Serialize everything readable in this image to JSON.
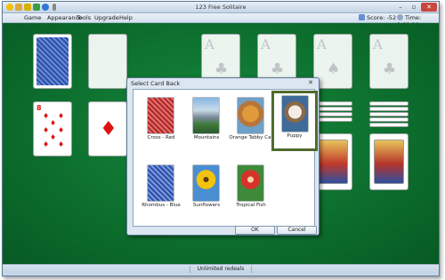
{
  "window": {
    "title": "123 Free Solitaire"
  },
  "menu": {
    "items": [
      "Game",
      "Appearance",
      "Tools",
      "Upgrade",
      "Help"
    ],
    "score_label": "Score: -52",
    "time_label": "Time: 0:01:19"
  },
  "dialog": {
    "title": "Select Card Back",
    "close_glyph": "✕",
    "options": [
      {
        "label": "Cross - Red"
      },
      {
        "label": "Mountains"
      },
      {
        "label": "Orange Tabby Cat"
      },
      {
        "label": "Puppy",
        "selected": true
      },
      {
        "label": "Rhombus - Blue"
      },
      {
        "label": "Sunflowers"
      },
      {
        "label": "Tropical Fish"
      }
    ],
    "ok_label": "OK",
    "cancel_label": "Cancel"
  },
  "cards": {
    "ace_rank": "A",
    "club_suit": "♣",
    "spade_suit": "♠",
    "eight_rank": "8",
    "diamond_suit": "♦"
  },
  "status": {
    "message": "Unlimited redeals"
  },
  "icons": {
    "quick_access": [
      "new-icon",
      "open-icon",
      "undo-icon",
      "hint-icon",
      "help-icon",
      "redo-icon"
    ],
    "score": "score-icon",
    "clock": "clock-icon"
  },
  "colors": {
    "table_green": "#0c6d2d",
    "selected_border": "#4f6b2f",
    "card_red": "#d11111"
  }
}
